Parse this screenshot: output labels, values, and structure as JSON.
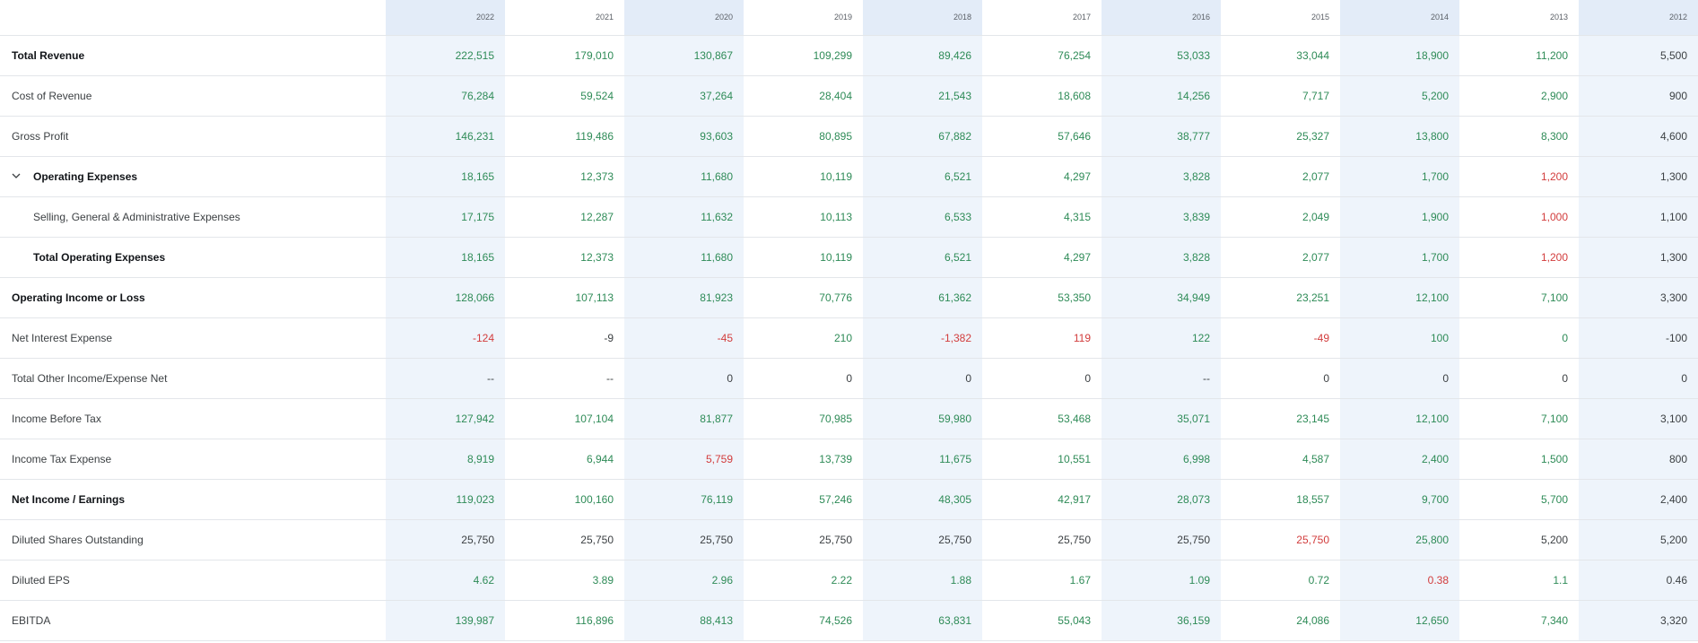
{
  "years": [
    "2022",
    "2021",
    "2020",
    "2019",
    "2018",
    "2017",
    "2016",
    "2015",
    "2014",
    "2013",
    "2012"
  ],
  "rows": [
    {
      "label": "Total Revenue",
      "bold": true,
      "indent": false,
      "expandable": false,
      "values": [
        "222,515",
        "179,010",
        "130,867",
        "109,299",
        "89,426",
        "76,254",
        "53,033",
        "33,044",
        "18,900",
        "11,200",
        "5,500"
      ],
      "tones": [
        "pos",
        "pos",
        "pos",
        "pos",
        "pos",
        "pos",
        "pos",
        "pos",
        "pos",
        "pos",
        "neu"
      ]
    },
    {
      "label": "Cost of Revenue",
      "bold": false,
      "indent": false,
      "expandable": false,
      "values": [
        "76,284",
        "59,524",
        "37,264",
        "28,404",
        "21,543",
        "18,608",
        "14,256",
        "7,717",
        "5,200",
        "2,900",
        "900"
      ],
      "tones": [
        "pos",
        "pos",
        "pos",
        "pos",
        "pos",
        "pos",
        "pos",
        "pos",
        "pos",
        "pos",
        "neu"
      ]
    },
    {
      "label": "Gross Profit",
      "bold": false,
      "indent": false,
      "expandable": false,
      "values": [
        "146,231",
        "119,486",
        "93,603",
        "80,895",
        "67,882",
        "57,646",
        "38,777",
        "25,327",
        "13,800",
        "8,300",
        "4,600"
      ],
      "tones": [
        "pos",
        "pos",
        "pos",
        "pos",
        "pos",
        "pos",
        "pos",
        "pos",
        "pos",
        "pos",
        "neu"
      ]
    },
    {
      "label": "Operating Expenses",
      "bold": true,
      "indent": false,
      "expandable": true,
      "values": [
        "18,165",
        "12,373",
        "11,680",
        "10,119",
        "6,521",
        "4,297",
        "3,828",
        "2,077",
        "1,700",
        "1,200",
        "1,300"
      ],
      "tones": [
        "pos",
        "pos",
        "pos",
        "pos",
        "pos",
        "pos",
        "pos",
        "pos",
        "pos",
        "neg",
        "neu"
      ]
    },
    {
      "label": "Selling, General & Administrative Expenses",
      "bold": false,
      "indent": true,
      "expandable": false,
      "values": [
        "17,175",
        "12,287",
        "11,632",
        "10,113",
        "6,533",
        "4,315",
        "3,839",
        "2,049",
        "1,900",
        "1,000",
        "1,100"
      ],
      "tones": [
        "pos",
        "pos",
        "pos",
        "pos",
        "pos",
        "pos",
        "pos",
        "pos",
        "pos",
        "neg",
        "neu"
      ]
    },
    {
      "label": "Total Operating Expenses",
      "bold": true,
      "indent": true,
      "expandable": false,
      "values": [
        "18,165",
        "12,373",
        "11,680",
        "10,119",
        "6,521",
        "4,297",
        "3,828",
        "2,077",
        "1,700",
        "1,200",
        "1,300"
      ],
      "tones": [
        "pos",
        "pos",
        "pos",
        "pos",
        "pos",
        "pos",
        "pos",
        "pos",
        "pos",
        "neg",
        "neu"
      ]
    },
    {
      "label": "Operating Income or Loss",
      "bold": true,
      "indent": false,
      "expandable": false,
      "values": [
        "128,066",
        "107,113",
        "81,923",
        "70,776",
        "61,362",
        "53,350",
        "34,949",
        "23,251",
        "12,100",
        "7,100",
        "3,300"
      ],
      "tones": [
        "pos",
        "pos",
        "pos",
        "pos",
        "pos",
        "pos",
        "pos",
        "pos",
        "pos",
        "pos",
        "neu"
      ]
    },
    {
      "label": "Net Interest Expense",
      "bold": false,
      "indent": false,
      "expandable": false,
      "values": [
        "-124",
        "-9",
        "-45",
        "210",
        "-1,382",
        "119",
        "122",
        "-49",
        "100",
        "0",
        "-100"
      ],
      "tones": [
        "neg",
        "neu",
        "neg",
        "pos",
        "neg",
        "neg",
        "pos",
        "neg",
        "pos",
        "pos",
        "neu"
      ]
    },
    {
      "label": "Total Other Income/Expense Net",
      "bold": false,
      "indent": false,
      "expandable": false,
      "values": [
        "--",
        "--",
        "0",
        "0",
        "0",
        "0",
        "--",
        "0",
        "0",
        "0",
        "0"
      ],
      "tones": [
        "neu",
        "neu",
        "neu",
        "neu",
        "neu",
        "neu",
        "neu",
        "neu",
        "neu",
        "neu",
        "neu"
      ]
    },
    {
      "label": "Income Before Tax",
      "bold": false,
      "indent": false,
      "expandable": false,
      "values": [
        "127,942",
        "107,104",
        "81,877",
        "70,985",
        "59,980",
        "53,468",
        "35,071",
        "23,145",
        "12,100",
        "7,100",
        "3,100"
      ],
      "tones": [
        "pos",
        "pos",
        "pos",
        "pos",
        "pos",
        "pos",
        "pos",
        "pos",
        "pos",
        "pos",
        "neu"
      ]
    },
    {
      "label": "Income Tax Expense",
      "bold": false,
      "indent": false,
      "expandable": false,
      "values": [
        "8,919",
        "6,944",
        "5,759",
        "13,739",
        "11,675",
        "10,551",
        "6,998",
        "4,587",
        "2,400",
        "1,500",
        "800"
      ],
      "tones": [
        "pos",
        "pos",
        "neg",
        "pos",
        "pos",
        "pos",
        "pos",
        "pos",
        "pos",
        "pos",
        "neu"
      ]
    },
    {
      "label": "Net Income / Earnings",
      "bold": true,
      "indent": false,
      "expandable": false,
      "values": [
        "119,023",
        "100,160",
        "76,119",
        "57,246",
        "48,305",
        "42,917",
        "28,073",
        "18,557",
        "9,700",
        "5,700",
        "2,400"
      ],
      "tones": [
        "pos",
        "pos",
        "pos",
        "pos",
        "pos",
        "pos",
        "pos",
        "pos",
        "pos",
        "pos",
        "neu"
      ]
    },
    {
      "label": "Diluted Shares Outstanding",
      "bold": false,
      "indent": false,
      "expandable": false,
      "values": [
        "25,750",
        "25,750",
        "25,750",
        "25,750",
        "25,750",
        "25,750",
        "25,750",
        "25,750",
        "25,800",
        "5,200",
        "5,200"
      ],
      "tones": [
        "neu",
        "neu",
        "neu",
        "neu",
        "neu",
        "neu",
        "neu",
        "neg",
        "pos",
        "neu",
        "neu"
      ]
    },
    {
      "label": "Diluted EPS",
      "bold": false,
      "indent": false,
      "expandable": false,
      "values": [
        "4.62",
        "3.89",
        "2.96",
        "2.22",
        "1.88",
        "1.67",
        "1.09",
        "0.72",
        "0.38",
        "1.1",
        "0.46"
      ],
      "tones": [
        "pos",
        "pos",
        "pos",
        "pos",
        "pos",
        "pos",
        "pos",
        "pos",
        "neg",
        "pos",
        "neu"
      ]
    },
    {
      "label": "EBITDA",
      "bold": false,
      "indent": false,
      "expandable": false,
      "values": [
        "139,987",
        "116,896",
        "88,413",
        "74,526",
        "63,831",
        "55,043",
        "36,159",
        "24,086",
        "12,650",
        "7,340",
        "3,320"
      ],
      "tones": [
        "pos",
        "pos",
        "pos",
        "pos",
        "pos",
        "pos",
        "pos",
        "pos",
        "pos",
        "pos",
        "neu"
      ]
    }
  ],
  "icons": {
    "expand": "chevron-down-icon"
  },
  "colors": {
    "positive": "#2e8b57",
    "negative": "#d23c3c",
    "neutral": "#3c4043"
  }
}
